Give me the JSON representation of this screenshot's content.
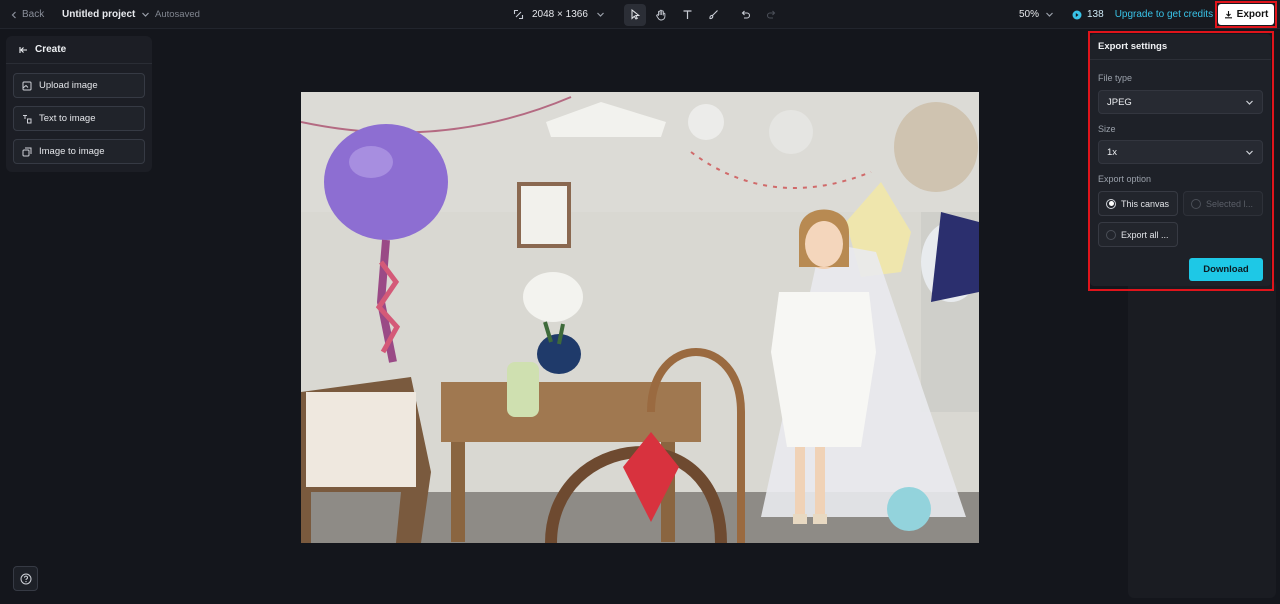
{
  "topbar": {
    "back_label": "Back",
    "project_title": "Untitled project",
    "autosave_status": "Autosaved",
    "canvas_size": "2048 × 1366",
    "zoom": "50%",
    "credits": "138",
    "upgrade_label": "Upgrade to get credits",
    "export_label": "Export"
  },
  "create_panel": {
    "title": "Create",
    "items": [
      {
        "label": "Upload image",
        "icon": "upload-image-icon"
      },
      {
        "label": "Text to image",
        "icon": "text-to-image-icon"
      },
      {
        "label": "Image to image",
        "icon": "image-to-image-icon"
      }
    ]
  },
  "export_settings": {
    "title": "Export settings",
    "file_type_label": "File type",
    "file_type_value": "JPEG",
    "size_label": "Size",
    "size_value": "1x",
    "export_option_label": "Export option",
    "options": [
      {
        "label": "This canvas",
        "selected": true,
        "enabled": true
      },
      {
        "label": "Selected l...",
        "selected": false,
        "enabled": false
      },
      {
        "label": "Export all ...",
        "selected": false,
        "enabled": true
      }
    ],
    "download_label": "Download"
  },
  "colors": {
    "accent": "#1ec8e6",
    "highlight": "#e0141b",
    "background": "#14161c"
  }
}
